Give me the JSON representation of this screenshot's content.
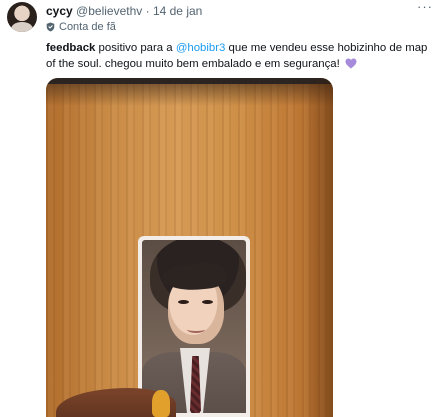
{
  "author": {
    "name": "cycy",
    "handle": "@believethv",
    "separator": "·",
    "date": "14 de jan"
  },
  "badge": {
    "icon": "shield-icon",
    "label": "Conta de fã"
  },
  "tweet": {
    "bold": "feedback",
    "text_before_mention": " positivo para a ",
    "mention": "@hobibr3",
    "text_after_mention": " que me vendeu esse hobizinho de map of the soul. chegou muito bem embalado e em segurança!",
    "emoji": "purple-heart-icon"
  },
  "menu": {
    "label": "···"
  },
  "colors": {
    "mention": "#1d9bf0",
    "secondary_text": "#536471",
    "heart": "#a78bdb"
  }
}
